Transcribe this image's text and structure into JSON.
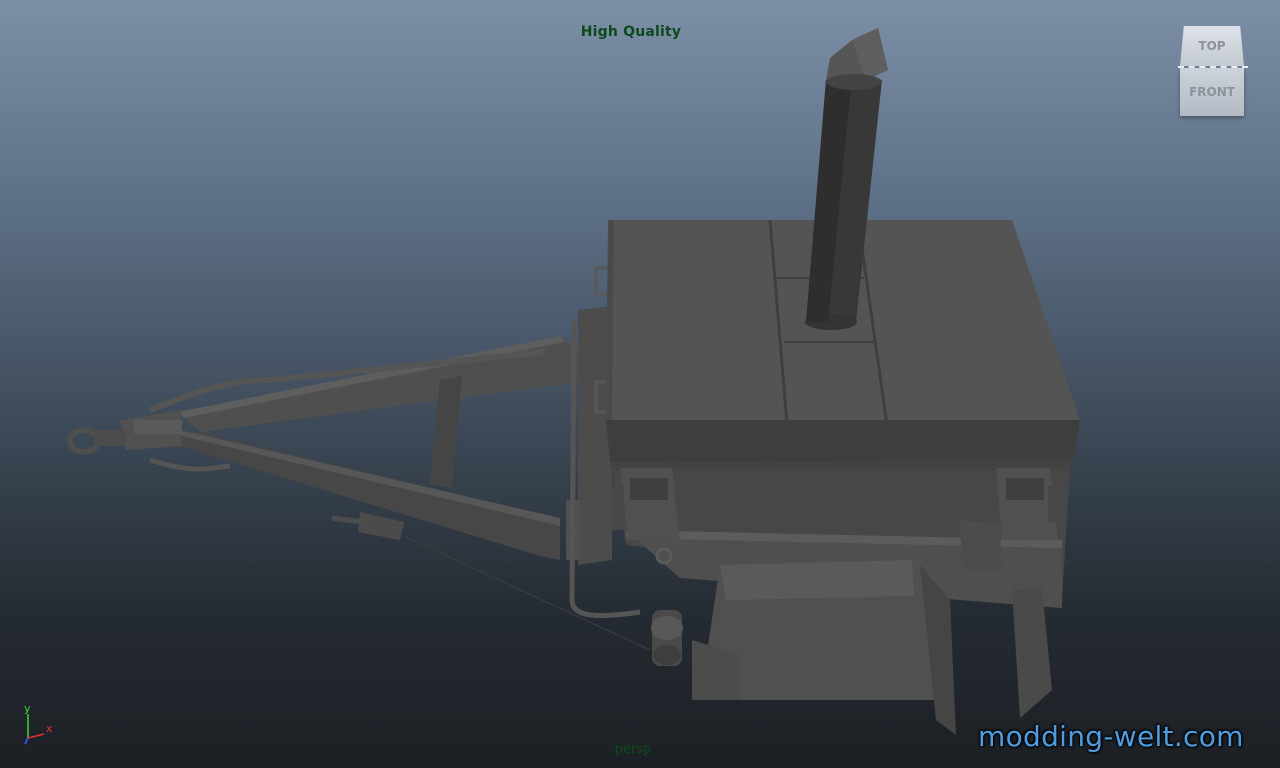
{
  "viewport": {
    "quality_mode": "High Quality",
    "camera": "persp",
    "background_colors": [
      "#7d8fa6",
      "#3d4a58",
      "#1c2025"
    ],
    "hud_text_color": "#0c4a1c"
  },
  "view_cube": {
    "top_label": "TOP",
    "front_label": "FRONT"
  },
  "axis_gizmo": {
    "y_label": "y",
    "x_label": "x",
    "y_color": "#3fd23f",
    "x_color": "#e23030",
    "z_color": "#3a4fe0"
  },
  "model": {
    "name_icon": "trailer-boiler-model",
    "base_color": "#4a4a4a"
  },
  "watermark": {
    "text": "modding-welt.com",
    "color": "#4f9de0"
  }
}
